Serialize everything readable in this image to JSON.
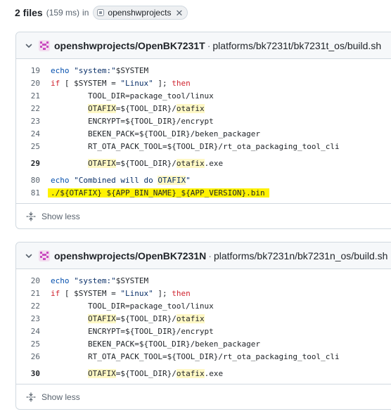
{
  "results": {
    "count": "2 files",
    "timing": "(159 ms)",
    "in": "in",
    "filter_chip": "openshwprojects"
  },
  "files": [
    {
      "repo": "openshwprojects/OpenBK7231T",
      "separator": "·",
      "path": "platforms/bk7231t/bk7231t_os/build.sh",
      "lines": [
        {
          "n": "19",
          "t": "echo \"system:\"$SYSTEM"
        },
        {
          "n": "20",
          "t": "if [ $SYSTEM = \"Linux\" ]; then"
        },
        {
          "n": "21",
          "t": "        TOOL_DIR=package_tool/linux"
        },
        {
          "n": "22",
          "t": "        OTAFIX=${TOOL_DIR}/otafix"
        },
        {
          "n": "23",
          "t": "        ENCRYPT=${TOOL_DIR}/encrypt"
        },
        {
          "n": "24",
          "t": "        BEKEN_PACK=${TOOL_DIR}/beken_packager"
        },
        {
          "n": "25",
          "t": "        RT_OTA_PACK_TOOL=${TOOL_DIR}/rt_ota_packaging_tool_cli"
        },
        {
          "n": "29",
          "t": "        OTAFIX=${TOOL_DIR}/otafix.exe"
        },
        {
          "n": "80",
          "t": "echo \"Combined will do OTAFIX\""
        },
        {
          "n": "81",
          "t": "./${OTAFIX} ${APP_BIN_NAME}_${APP_VERSION}.bin"
        }
      ],
      "show_less": "Show less"
    },
    {
      "repo": "openshwprojects/OpenBK7231N",
      "separator": "·",
      "path": "platforms/bk7231n/bk7231n_os/build.sh",
      "lines": [
        {
          "n": "20",
          "t": "echo \"system:\"$SYSTEM"
        },
        {
          "n": "21",
          "t": "if [ $SYSTEM = \"Linux\" ]; then"
        },
        {
          "n": "22",
          "t": "        TOOL_DIR=package_tool/linux"
        },
        {
          "n": "23",
          "t": "        OTAFIX=${TOOL_DIR}/otafix"
        },
        {
          "n": "24",
          "t": "        ENCRYPT=${TOOL_DIR}/encrypt"
        },
        {
          "n": "25",
          "t": "        BEKEN_PACK=${TOOL_DIR}/beken_packager"
        },
        {
          "n": "26",
          "t": "        RT_OTA_PACK_TOOL=${TOOL_DIR}/rt_ota_packaging_tool_cli"
        },
        {
          "n": "30",
          "t": "        OTAFIX=${TOOL_DIR}/otafix.exe"
        }
      ],
      "show_less": "Show less"
    }
  ],
  "colors": {
    "match_highlight": "#fff8c5",
    "selected_line_highlight": "#fff200",
    "keyword": "#cf222e",
    "builtin": "#0550ae",
    "border": "#d1d9e0"
  },
  "icons": [
    "repo-avatar-icon",
    "chevron-down-icon",
    "close-icon",
    "fold-icon",
    "org-icon"
  ]
}
